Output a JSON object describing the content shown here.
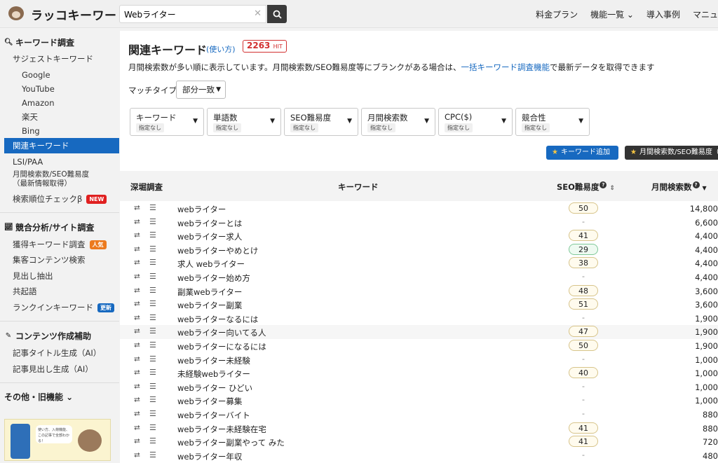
{
  "header": {
    "logo_text": "ラッコキーワード",
    "search_value": "Webライター",
    "nav": [
      "料金プラン",
      "機能一覧 ⌄",
      "導入事例",
      "マニュ"
    ]
  },
  "sidebar": {
    "sections": [
      {
        "label": "キーワード調査"
      },
      {
        "label": "競合分析/サイト調査"
      },
      {
        "label": "コンテンツ作成補助"
      },
      {
        "label": "その他・旧機能 ⌄"
      }
    ],
    "items": {
      "suggest": "サジェストキーワード",
      "google": "Google",
      "youtube": "YouTube",
      "amazon": "Amazon",
      "rakuten": "楽天",
      "bing": "Bing",
      "related": "関連キーワード",
      "lsi": "LSI/PAA",
      "monthly1": "月間検索数/SEO難易度",
      "monthly2": "（最新情報取得）",
      "rank_check": "検索順位チェックβ",
      "acquired": "獲得キーワード調査",
      "content_search": "集客コンテンツ検索",
      "heading_extract": "見出し抽出",
      "cooccur": "共起語",
      "rankin": "ランクインキーワード",
      "title_gen": "記事タイトル生成（AI）",
      "heading_gen": "記事見出し生成（AI）"
    },
    "badges": {
      "new": "NEW",
      "popular": "人気",
      "updated": "更新"
    },
    "promo_text": "使い方、入荷機能、この記事で全部わかる！"
  },
  "main": {
    "title": "関連キーワード",
    "howto": "(使い方)",
    "hit_count": "2263",
    "hit_unit": "HIT",
    "desc_before": "月間検索数が多い順に表示しています。月間検索数/SEO難易度等にブランクがある場合は、",
    "desc_link": "一括キーワード調査機能",
    "desc_after": "で最新データを取得できます",
    "match_label": "マッチタイプ",
    "match_value": "部分一致",
    "filters": [
      {
        "label": "キーワード",
        "sub": "指定なし"
      },
      {
        "label": "単語数",
        "sub": "指定なし"
      },
      {
        "label": "SEO難易度",
        "sub": "指定なし"
      },
      {
        "label": "月間検索数",
        "sub": "指定なし"
      },
      {
        "label": "CPC($)",
        "sub": "指定なし"
      },
      {
        "label": "競合性",
        "sub": "指定なし"
      }
    ],
    "btn_add": "キーワード追加",
    "btn_monthly": "月間検索数/SEO難易度（"
  },
  "table": {
    "headers": {
      "dig": "深堀調査",
      "keyword": "キーワード",
      "seo": "SEO難易度",
      "volume": "月間検索数"
    },
    "rows": [
      {
        "kw": "webライター",
        "seo": "50",
        "vol": "14,800"
      },
      {
        "kw": "webライターとは",
        "seo": "-",
        "vol": "6,600"
      },
      {
        "kw": "webライター求人",
        "seo": "41",
        "vol": "4,400"
      },
      {
        "kw": "webライターやめとけ",
        "seo": "29",
        "vol": "4,400"
      },
      {
        "kw": "求人 webライター",
        "seo": "38",
        "vol": "4,400"
      },
      {
        "kw": "webライター始め方",
        "seo": "-",
        "vol": "4,400"
      },
      {
        "kw": "副業webライター",
        "seo": "48",
        "vol": "3,600"
      },
      {
        "kw": "webライター副業",
        "seo": "51",
        "vol": "3,600"
      },
      {
        "kw": "webライターなるには",
        "seo": "-",
        "vol": "1,900"
      },
      {
        "kw": "webライター向いてる人",
        "seo": "47",
        "vol": "1,900"
      },
      {
        "kw": "webライターになるには",
        "seo": "50",
        "vol": "1,900"
      },
      {
        "kw": "webライター未経験",
        "seo": "-",
        "vol": "1,000"
      },
      {
        "kw": "未経験webライター",
        "seo": "40",
        "vol": "1,000"
      },
      {
        "kw": "webライター ひどい",
        "seo": "-",
        "vol": "1,000"
      },
      {
        "kw": "webライター募集",
        "seo": "-",
        "vol": "1,000"
      },
      {
        "kw": "webライターバイト",
        "seo": "-",
        "vol": "880"
      },
      {
        "kw": "webライター未経験在宅",
        "seo": "41",
        "vol": "880"
      },
      {
        "kw": "webライター副業やって みた",
        "seo": "41",
        "vol": "720"
      },
      {
        "kw": "webライター年収",
        "seo": "-",
        "vol": "480"
      }
    ]
  }
}
